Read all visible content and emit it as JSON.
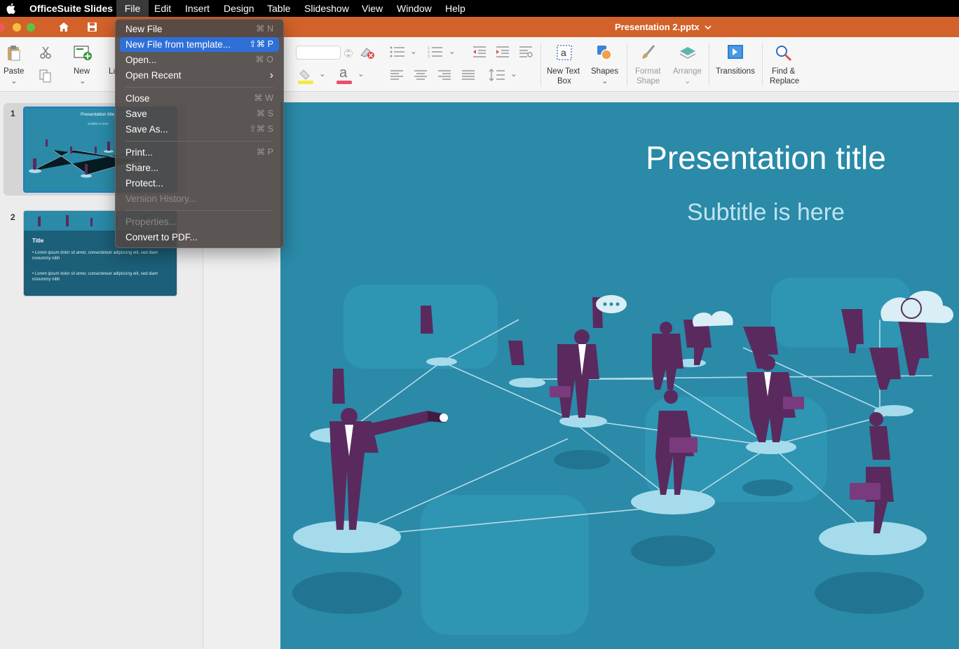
{
  "menubar": {
    "apple_icon": "apple-logo",
    "app_name": "OfficeSuite Slides",
    "items": [
      "File",
      "Edit",
      "Insert",
      "Design",
      "Table",
      "Slideshow",
      "View",
      "Window",
      "Help"
    ]
  },
  "titlebar": {
    "title": "Presentation 2.pptx",
    "chevron": "⌄",
    "color": "#d2622a"
  },
  "ribbon": {
    "paste": "Paste",
    "new": "New",
    "layout_partial": "La",
    "new_text_box": [
      "New Text",
      "Box"
    ],
    "shapes": "Shapes",
    "format_shape": [
      "Format",
      "Shape"
    ],
    "arrange": "Arrange",
    "transitions": "Transitions",
    "find_replace": [
      "Find &",
      "Replace"
    ],
    "font_color_letter": "a"
  },
  "file_menu": {
    "groups": [
      [
        {
          "label": "New File",
          "shortcut": "⌘ N",
          "selected": false,
          "disabled": false
        },
        {
          "label": "New File from template...",
          "shortcut": "⇧⌘ P",
          "selected": true,
          "disabled": false
        },
        {
          "label": "Open...",
          "shortcut": "⌘ O",
          "selected": false,
          "disabled": false
        },
        {
          "label": "Open Recent",
          "shortcut": "›",
          "selected": false,
          "disabled": false
        }
      ],
      [
        {
          "label": "Close",
          "shortcut": "⌘ W",
          "selected": false,
          "disabled": false
        },
        {
          "label": "Save",
          "shortcut": "⌘ S",
          "selected": false,
          "disabled": false
        },
        {
          "label": "Save As...",
          "shortcut": "⇧⌘ S",
          "selected": false,
          "disabled": false
        }
      ],
      [
        {
          "label": "Print...",
          "shortcut": "⌘ P",
          "selected": false,
          "disabled": false
        },
        {
          "label": "Share...",
          "shortcut": "",
          "selected": false,
          "disabled": false
        },
        {
          "label": "Protect...",
          "shortcut": "",
          "selected": false,
          "disabled": false
        },
        {
          "label": "Version History...",
          "shortcut": "",
          "selected": false,
          "disabled": true
        }
      ],
      [
        {
          "label": "Properties...",
          "shortcut": "",
          "selected": false,
          "disabled": true
        },
        {
          "label": "Convert to PDF...",
          "shortcut": "",
          "selected": false,
          "disabled": false
        }
      ]
    ]
  },
  "thumbnails": [
    {
      "number": "1",
      "title": "Presentation title",
      "subtitle": "Subtitle is here",
      "selected": true
    },
    {
      "number": "2",
      "title": "Title",
      "bullets": [
        "Lorem ipsum dolor sit amet, consectetuer adipiscing elit, sed diam nonummy nibh",
        "Lorem ipsum dolor sit amet, consectetuer adipiscing elit, sed diam nonummy nibh"
      ],
      "selected": false
    }
  ],
  "slide": {
    "title": "Presentation title",
    "subtitle": "Subtitle is here",
    "bg_color": "#2a8aa8"
  }
}
